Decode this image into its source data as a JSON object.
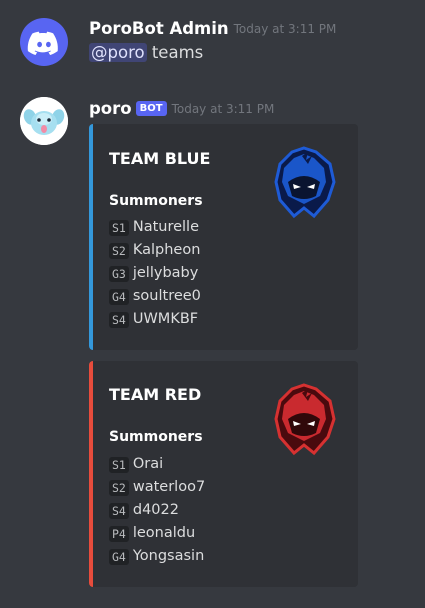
{
  "messages": [
    {
      "username": "PoroBot Admin",
      "timestamp": "Today at 3:11 PM",
      "mention": "@poro",
      "text": " teams"
    },
    {
      "username": "poro",
      "bot_tag": "BOT",
      "timestamp": "Today at 3:11 PM"
    }
  ],
  "embeds": [
    {
      "title": "TEAM BLUE",
      "color": "#3498db",
      "field_name": "Summoners",
      "summoners": [
        {
          "role": "S1",
          "name": "Naturelle"
        },
        {
          "role": "S2",
          "name": "Kalpheon"
        },
        {
          "role": "G3",
          "name": "jellybaby"
        },
        {
          "role": "G4",
          "name": "soultree0"
        },
        {
          "role": "S4",
          "name": "UWMKBF"
        }
      ],
      "thumbnail_icon": "blue-hooded-mascot-icon"
    },
    {
      "title": "TEAM RED",
      "color": "#e74c3c",
      "field_name": "Summoners",
      "summoners": [
        {
          "role": "S1",
          "name": "Orai"
        },
        {
          "role": "S2",
          "name": "waterloo7"
        },
        {
          "role": "S4",
          "name": "d4022"
        },
        {
          "role": "P4",
          "name": "leonaldu"
        },
        {
          "role": "G4",
          "name": "Yongsasin"
        }
      ],
      "thumbnail_icon": "red-hooded-mascot-icon"
    }
  ]
}
